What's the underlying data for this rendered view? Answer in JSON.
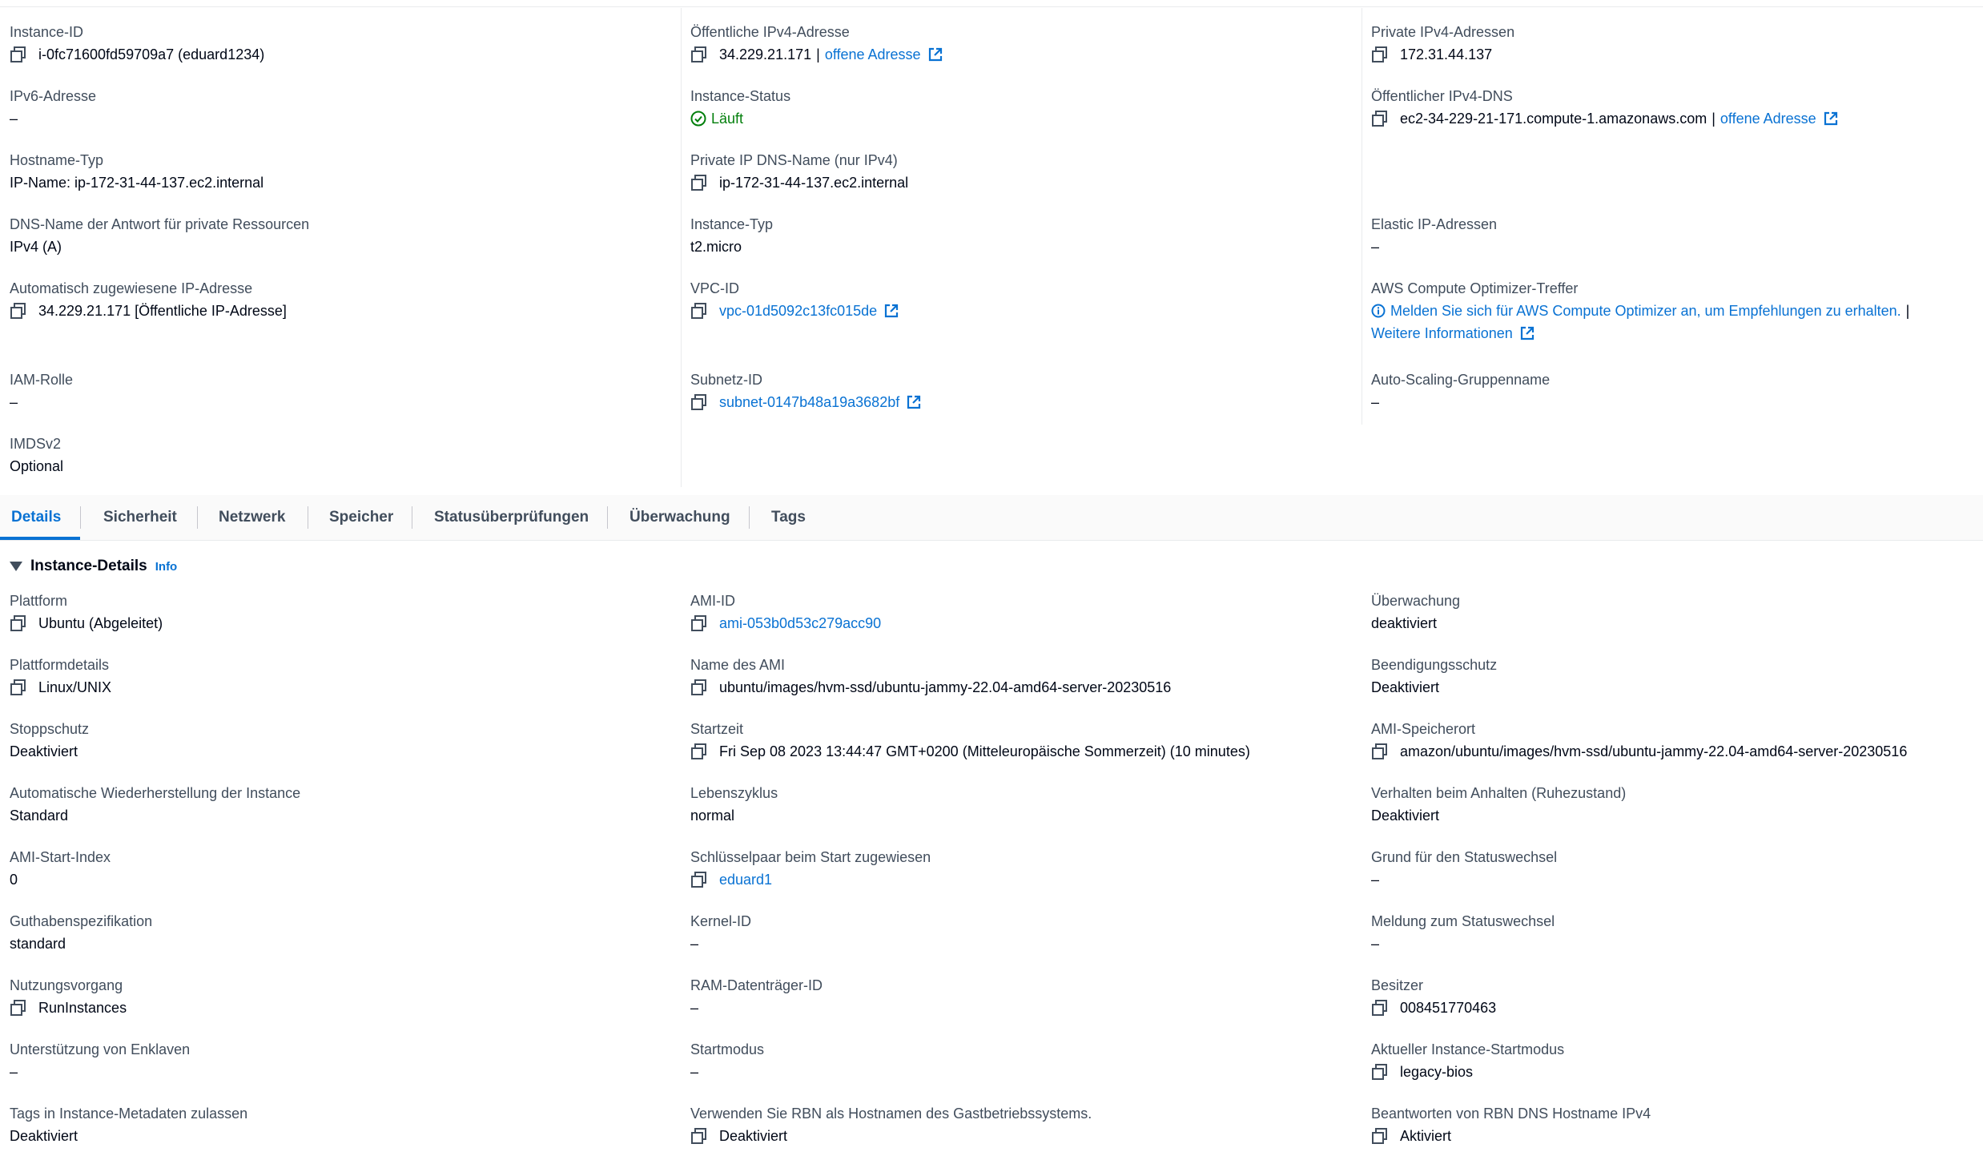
{
  "summary": {
    "instance_id": {
      "label": "Instance-ID",
      "value": "i-0fc71600fd59709a7 (eduard1234)"
    },
    "public_ipv4": {
      "label": "Öffentliche IPv4-Adresse",
      "value": "34.229.21.171",
      "sep": "|",
      "link": "offene Adresse"
    },
    "private_ipv4": {
      "label": "Private IPv4-Adressen",
      "value": "172.31.44.137"
    },
    "ipv6": {
      "label": "IPv6-Adresse",
      "value": "–"
    },
    "instance_status": {
      "label": "Instance-Status",
      "value": "Läuft"
    },
    "public_dns": {
      "label": "Öffentlicher IPv4-DNS",
      "value": "ec2-34-229-21-171.compute-1.amazonaws.com",
      "sep": "|",
      "link": "offene Adresse"
    },
    "hostname_type": {
      "label": "Hostname-Typ",
      "value": "IP-Name: ip-172-31-44-137.ec2.internal"
    },
    "private_ip_dns": {
      "label": "Private IP DNS-Name (nur IPv4)",
      "value": "ip-172-31-44-137.ec2.internal"
    },
    "dns_answer": {
      "label": "DNS-Name der Antwort für private Ressourcen",
      "value": "IPv4 (A)"
    },
    "instance_type": {
      "label": "Instance-Typ",
      "value": "t2.micro"
    },
    "elastic_ip": {
      "label": "Elastic IP-Adressen",
      "value": "–"
    },
    "auto_ip": {
      "label": "Automatisch zugewiesene IP-Adresse",
      "value": "34.229.21.171 [Öffentliche IP-Adresse]"
    },
    "vpc_id": {
      "label": "VPC-ID",
      "value": "vpc-01d5092c13fc015de"
    },
    "optimizer": {
      "label": "AWS Compute Optimizer-Treffer",
      "message": "Melden Sie sich für AWS Compute Optimizer an, um Empfehlungen zu erhalten.",
      "sep": "|",
      "link": "Weitere Informationen"
    },
    "iam_role": {
      "label": "IAM-Rolle",
      "value": "–"
    },
    "subnet_id": {
      "label": "Subnetz-ID",
      "value": "subnet-0147b48a19a3682bf"
    },
    "asg_name": {
      "label": "Auto-Scaling-Gruppenname",
      "value": "–"
    },
    "imdsv2": {
      "label": "IMDSv2",
      "value": "Optional"
    }
  },
  "tabs": [
    "Details",
    "Sicherheit",
    "Netzwerk",
    "Speicher",
    "Statusüberprüfungen",
    "Überwachung",
    "Tags"
  ],
  "section": {
    "title": "Instance-Details",
    "info": "Info"
  },
  "details": {
    "platform": {
      "label": "Plattform",
      "value": "Ubuntu (Abgeleitet)"
    },
    "ami_id": {
      "label": "AMI-ID",
      "value": "ami-053b0d53c279acc90"
    },
    "monitoring": {
      "label": "Überwachung",
      "value": "deaktiviert"
    },
    "platform_details": {
      "label": "Plattformdetails",
      "value": "Linux/UNIX"
    },
    "ami_name": {
      "label": "Name des AMI",
      "value": "ubuntu/images/hvm-ssd/ubuntu-jammy-22.04-amd64-server-20230516"
    },
    "termination_protection": {
      "label": "Beendigungsschutz",
      "value": "Deaktiviert"
    },
    "stop_protection": {
      "label": "Stoppschutz",
      "value": "Deaktiviert"
    },
    "launch_time": {
      "label": "Startzeit",
      "value": "Fri Sep 08 2023 13:44:47 GMT+0200 (Mitteleuropäische Sommerzeit) (10 minutes)"
    },
    "ami_location": {
      "label": "AMI-Speicherort",
      "value": "amazon/ubuntu/images/hvm-ssd/ubuntu-jammy-22.04-amd64-server-20230516"
    },
    "auto_recovery": {
      "label": "Automatische Wiederherstellung der Instance",
      "value": "Standard"
    },
    "lifecycle": {
      "label": "Lebenszyklus",
      "value": "normal"
    },
    "stop_hibernate": {
      "label": "Verhalten beim Anhalten (Ruhezustand)",
      "value": "Deaktiviert"
    },
    "ami_launch_index": {
      "label": "AMI-Start-Index",
      "value": "0"
    },
    "key_pair": {
      "label": "Schlüsselpaar beim Start zugewiesen",
      "value": "eduard1"
    },
    "state_reason": {
      "label": "Grund für den Statuswechsel",
      "value": "–"
    },
    "credit_spec": {
      "label": "Guthabenspezifikation",
      "value": "standard"
    },
    "kernel_id": {
      "label": "Kernel-ID",
      "value": "–"
    },
    "state_message": {
      "label": "Meldung zum Statuswechsel",
      "value": "–"
    },
    "usage_operation": {
      "label": "Nutzungsvorgang",
      "value": "RunInstances"
    },
    "ramdisk_id": {
      "label": "RAM-Datenträger-ID",
      "value": "–"
    },
    "owner": {
      "label": "Besitzer",
      "value": "008451770463"
    },
    "enclave_support": {
      "label": "Unterstützung von Enklaven",
      "value": "–"
    },
    "boot_mode": {
      "label": "Startmodus",
      "value": "–"
    },
    "current_boot_mode": {
      "label": "Aktueller Instance-Startmodus",
      "value": "legacy-bios"
    },
    "metadata_tags": {
      "label": "Tags in Instance-Metadaten zulassen",
      "value": "Deaktiviert"
    },
    "rbn_hostname": {
      "label": "Verwenden Sie RBN als Hostnamen des Gastbetriebssystems.",
      "value": "Deaktiviert"
    },
    "rbn_dns": {
      "label": "Beantworten von RBN DNS Hostname IPv4",
      "value": "Aktiviert"
    }
  },
  "colors": {
    "link": "#0972d3",
    "success": "#037f0c",
    "label": "#414d5c",
    "text": "#000716"
  }
}
